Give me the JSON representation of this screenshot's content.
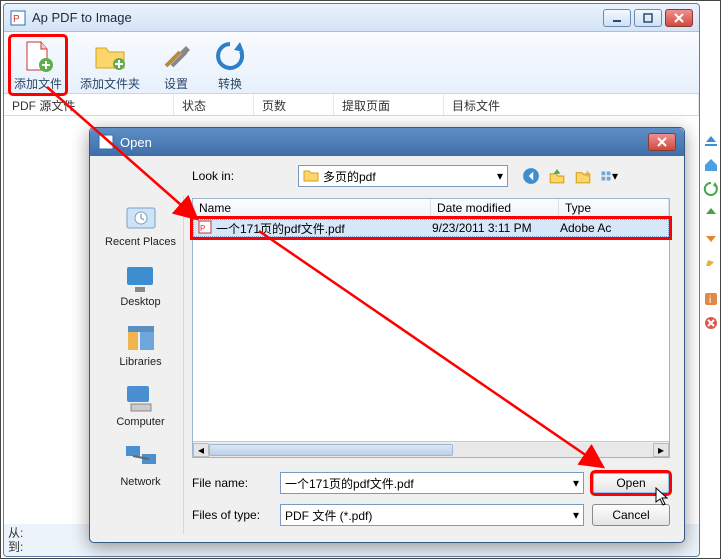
{
  "main": {
    "title": "Ap PDF to Image",
    "toolbar": [
      {
        "id": "add-file",
        "label": "添加文件"
      },
      {
        "id": "add-folder",
        "label": "添加文件夹"
      },
      {
        "id": "settings",
        "label": "设置"
      },
      {
        "id": "convert",
        "label": "转换"
      }
    ],
    "columns": {
      "source": "PDF 源文件",
      "status": "状态",
      "pages": "页数",
      "extract": "提取页面",
      "target": "目标文件"
    },
    "status": {
      "from": "从:",
      "to": "到:"
    }
  },
  "dialog": {
    "title": "Open",
    "lookin_label": "Look in:",
    "lookin_value": "多页的pdf",
    "places": [
      "Recent Places",
      "Desktop",
      "Libraries",
      "Computer",
      "Network"
    ],
    "columns": {
      "name": "Name",
      "date": "Date modified",
      "type": "Type"
    },
    "file": {
      "name": "一个171页的pdf文件.pdf",
      "date": "9/23/2011 3:11 PM",
      "type": "Adobe Ac"
    },
    "filename_label": "File name:",
    "filetype_label": "Files of type:",
    "filename_value": "一个171页的pdf文件.pdf",
    "filetype_value": "PDF 文件 (*.pdf)",
    "open_btn": "Open",
    "cancel_btn": "Cancel"
  }
}
